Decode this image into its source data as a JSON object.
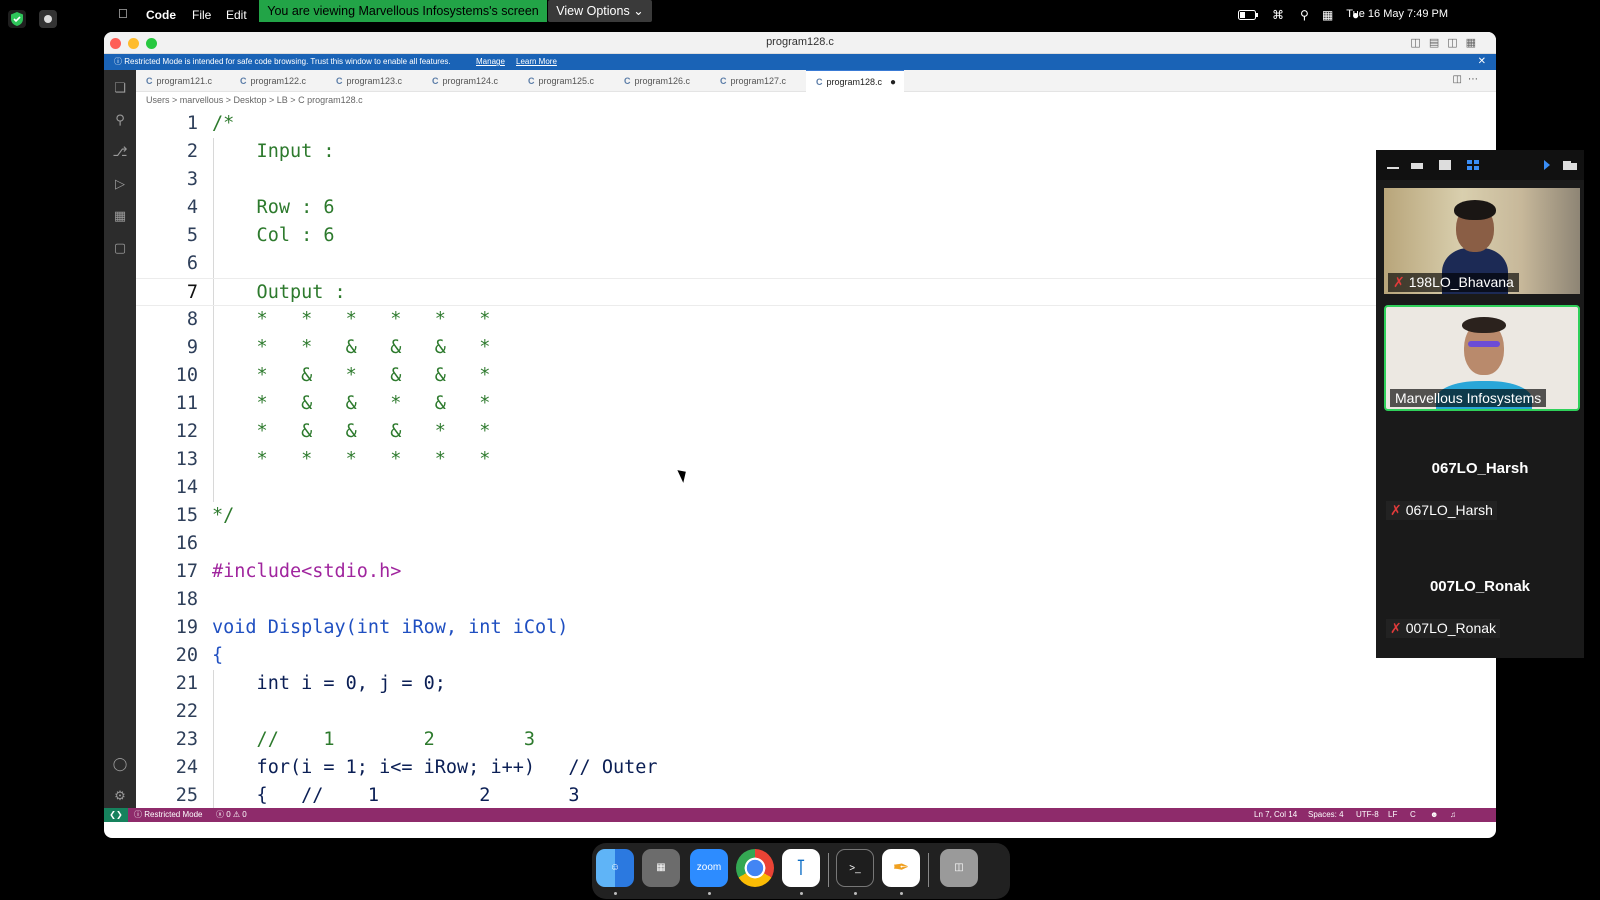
{
  "menubar": {
    "apple": "",
    "app_name": "Code",
    "menus": [
      "File",
      "Edit"
    ],
    "share_banner": "You are viewing Marvellous Infosystems's screen",
    "view_options": "View Options",
    "datetime": "Tue 16 May  7:49 PM"
  },
  "window": {
    "title": "program128.c",
    "restricted_notice": "Restricted Mode is intended for safe code browsing. Trust this window to enable all features.",
    "manage_link": "Manage",
    "learn_more_link": "Learn More",
    "tabs": [
      {
        "label": "program121.c"
      },
      {
        "label": "program122.c"
      },
      {
        "label": "program123.c"
      },
      {
        "label": "program124.c"
      },
      {
        "label": "program125.c"
      },
      {
        "label": "program126.c"
      },
      {
        "label": "program127.c"
      },
      {
        "label": "program128.c",
        "active": true,
        "modified": true
      }
    ],
    "breadcrumb": [
      "Users",
      "marvellous",
      "Desktop",
      "LB",
      "program128.c"
    ],
    "breadcrumb_text": "Users  >  marvellous  >  Desktop  >  LB  >  C  program128.c",
    "code_lines": [
      {
        "n": "1",
        "text": "/*"
      },
      {
        "n": "2",
        "text": "    Input :"
      },
      {
        "n": "3",
        "text": ""
      },
      {
        "n": "4",
        "text": "    Row : 6"
      },
      {
        "n": "5",
        "text": "    Col : 6"
      },
      {
        "n": "6",
        "text": ""
      },
      {
        "n": "7",
        "text": "    Output :"
      },
      {
        "n": "8",
        "text": "    *   *   *   *   *   *"
      },
      {
        "n": "9",
        "text": "    *   *   &   &   &   *"
      },
      {
        "n": "10",
        "text": "    *   &   *   &   &   *"
      },
      {
        "n": "11",
        "text": "    *   &   &   *   &   *"
      },
      {
        "n": "12",
        "text": "    *   &   &   &   *   *"
      },
      {
        "n": "13",
        "text": "    *   *   *   *   *   *"
      },
      {
        "n": "14",
        "text": ""
      },
      {
        "n": "15",
        "text": "*/"
      },
      {
        "n": "16",
        "text": ""
      },
      {
        "n": "17",
        "text": "#include<stdio.h>"
      },
      {
        "n": "18",
        "text": ""
      },
      {
        "n": "19",
        "text": "void Display(int iRow, int iCol)"
      },
      {
        "n": "20",
        "text": "{"
      },
      {
        "n": "21",
        "text": "    int i = 0, j = 0;"
      },
      {
        "n": "22",
        "text": ""
      },
      {
        "n": "23",
        "text": "    //    1        2        3"
      },
      {
        "n": "24",
        "text": "    for(i = 1; i<= iRow; i++)   // Outer"
      },
      {
        "n": "25",
        "text": "    {   //    1         2       3"
      }
    ],
    "status": {
      "mode": "Restricted Mode",
      "problems": "0 ⚠ 0",
      "position": "Ln 7, Col 14",
      "spaces": "Spaces: 4",
      "encoding": "UTF-8",
      "eol": "LF",
      "language": "C"
    }
  },
  "participants": [
    {
      "name": "198LO_Bhavana",
      "muted": true,
      "video": true
    },
    {
      "name": "Marvellous Infosystems",
      "muted": false,
      "video": true,
      "active_speaker": true
    },
    {
      "name": "067LO_Harsh",
      "muted": true,
      "video": false
    },
    {
      "name": "007LO_Ronak",
      "muted": true,
      "video": false
    }
  ],
  "dock": [
    "Finder",
    "Launchpad",
    "zoom",
    "Chrome",
    "VS Code",
    "Terminal",
    "Pages",
    "Trash"
  ],
  "colors": {
    "share_banner": "#22a447",
    "restricted_bar": "#1a63b6",
    "status_bar": "#8e2b6b",
    "comment": "#2d7a2d",
    "keyword": "#1f4fc1",
    "speaker_border": "#2fd05a"
  }
}
